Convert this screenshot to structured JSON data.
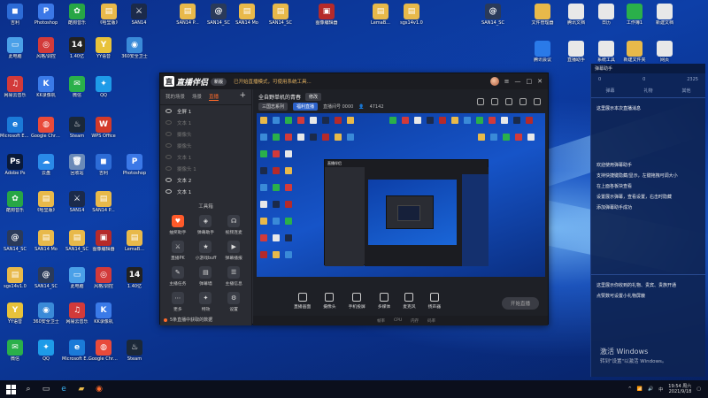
{
  "desktop": {
    "icons": [
      {
        "label": "吉利",
        "color": "#2d6cd6",
        "glyph": "◼"
      },
      {
        "label": "Photoshop",
        "color": "#3b78e7",
        "glyph": "P"
      },
      {
        "label": "酷狗音乐",
        "color": "#27a645",
        "glyph": "✿"
      },
      {
        "label": "《哈里版》",
        "color": "#e8b94a",
        "glyph": "▤"
      },
      {
        "label": "SAN14",
        "color": "#1b2a4a",
        "glyph": "⚔"
      },
      {
        "label": "SAN14 P...",
        "color": "#e8b94a",
        "glyph": "▤"
      },
      {
        "label": "SAN14_SC",
        "color": "#2a3a5a",
        "glyph": "@"
      },
      {
        "label": "SAN14 Mo",
        "color": "#e8b94a",
        "glyph": "▤"
      },
      {
        "label": "SAN14_SC",
        "color": "#e8b94a",
        "glyph": "▤"
      },
      {
        "label": "图像编辑器",
        "color": "#b52a2a",
        "glyph": "▣"
      },
      {
        "label": "LemaB...",
        "color": "#e8b94a",
        "glyph": "▤"
      },
      {
        "label": "sgs14v1.0",
        "color": "#e8b94a",
        "glyph": "▤"
      },
      {
        "label": "SAN14_SC",
        "color": "#2a3a5a",
        "glyph": "@"
      },
      {
        "label": "此电脑",
        "color": "#4aa0e8",
        "glyph": "▭"
      },
      {
        "label": "风格/调控",
        "color": "#d23a3a",
        "glyph": "◎"
      },
      {
        "label": "1.40亿",
        "color": "#222",
        "glyph": "14"
      },
      {
        "label": "YY语音",
        "color": "#e8c23a",
        "glyph": "Y"
      },
      {
        "label": "360安全卫士",
        "color": "#3a8ad8",
        "glyph": "◉"
      },
      {
        "label": "网易云音乐",
        "color": "#d23a3a",
        "glyph": "♫"
      },
      {
        "label": "KK录像机",
        "color": "#3a7ae8",
        "glyph": "K"
      },
      {
        "label": "微信",
        "color": "#2ab04a",
        "glyph": "✉"
      },
      {
        "label": "QQ",
        "color": "#1e9be8",
        "glyph": "✦"
      },
      {
        "label": "Microsoft Edge",
        "color": "#1b7ad8",
        "glyph": "e"
      },
      {
        "label": "Google Chrome",
        "color": "#e84a3a",
        "glyph": "◍"
      },
      {
        "label": "Steam",
        "color": "#1b2838",
        "glyph": "♨"
      },
      {
        "label": "WPS Office",
        "color": "#d33a2a",
        "glyph": "W"
      },
      {
        "label": "Adobe Ps",
        "color": "#0a1a3a",
        "glyph": "Ps"
      },
      {
        "label": "云盘",
        "color": "#2a8ae8",
        "glyph": "☁"
      },
      {
        "label": "回收站",
        "color": "#6a8ab8",
        "glyph": "🗑"
      }
    ],
    "right_icons": [
      {
        "label": "文件管理器",
        "color": "#e8b94a"
      },
      {
        "label": "腾讯文档",
        "color": "#e8e8e8"
      },
      {
        "label": "日历",
        "color": "#e8e8e8"
      },
      {
        "label": "工作簿1",
        "color": "#2ab04a"
      },
      {
        "label": "新建文档",
        "color": "#e8e8e8"
      },
      {
        "label": "腾讯会议",
        "color": "#2a7ae8"
      },
      {
        "label": "直播助手",
        "color": "#e8e8e8"
      },
      {
        "label": "系统工具",
        "color": "#e8e8e8"
      },
      {
        "label": "新建文件夹",
        "color": "#e8b94a"
      },
      {
        "label": "网页",
        "color": "#e8e8e8"
      }
    ]
  },
  "app": {
    "logo_badge": "直",
    "name": "直播伴侣",
    "version": "新版",
    "notice": "已开始直播模式，可使用系统工具...",
    "sidebar": {
      "tabs": [
        "我的场景",
        "场景",
        "直播"
      ],
      "active_tab": "直播",
      "scenes": [
        {
          "label": "全屏 1",
          "dim": false
        },
        {
          "label": "文本 1",
          "dim": true
        },
        {
          "label": "摄像头",
          "dim": true
        },
        {
          "label": "摄像头",
          "dim": true
        },
        {
          "label": "文本 1",
          "dim": true
        },
        {
          "label": "摄像头 1",
          "dim": true
        },
        {
          "label": "文本 2",
          "dim": false
        },
        {
          "label": "文本 1",
          "dim": false
        }
      ],
      "tools_label": "工具箱",
      "tools": [
        {
          "label": "抽奖助手",
          "hot": true,
          "glyph": "♥"
        },
        {
          "label": "弹幕助手",
          "hot": false,
          "glyph": "◈"
        },
        {
          "label": "视频连麦",
          "hot": false,
          "glyph": "☊"
        },
        {
          "label": "直播PK",
          "hot": false,
          "glyph": "⚔"
        },
        {
          "label": "小游戏buff",
          "hot": false,
          "glyph": "★"
        },
        {
          "label": "弹幕播报",
          "hot": false,
          "glyph": "▶"
        },
        {
          "label": "主播任务",
          "hot": false,
          "glyph": "✎"
        },
        {
          "label": "弹幕墙",
          "hot": false,
          "glyph": "▤"
        },
        {
          "label": "主播信息",
          "hot": false,
          "glyph": "☰"
        },
        {
          "label": "更多",
          "hot": false,
          "glyph": "⋯"
        },
        {
          "label": "特效",
          "hot": false,
          "glyph": "✦"
        },
        {
          "label": "设置",
          "hot": false,
          "glyph": "⚙"
        }
      ],
      "footer": "5条直播中获取的数据"
    },
    "stream_title": "全自野单机的青春",
    "edit_label": "修改",
    "meta": {
      "category": "三国志系列",
      "tag": "福利直播",
      "room_id": "直播间号 0000",
      "viewers": "47142"
    },
    "controls": [
      "直播画面",
      "摄像头",
      "手机投屏",
      "多媒体",
      "麦克风",
      "扬声器"
    ],
    "start_live": "开始直播",
    "status": [
      "帧率",
      "CPU",
      "内存",
      "码率"
    ]
  },
  "rpanel": {
    "head": "弹幕助手",
    "stats": [
      "0",
      "0",
      "2325"
    ],
    "tabs": [
      "弹幕",
      "礼物",
      "其他"
    ],
    "title": "这里展示本次直播消息",
    "messages": [
      "欢迎使用弹幕助手",
      "支持快捷键隐藏/显示，左键拖拽可调大小",
      "在上面各板块查看",
      "设置展示弹幕，查看设置，右击时隐藏",
      "添加弹幕助手成功"
    ],
    "bottom": [
      "这里展示你收到的礼物、贵宾、贵族开通",
      "点赞数可设置小礼物屏蔽"
    ]
  },
  "watermark": {
    "title": "激活 Windows",
    "sub": "转到\"设置\"以激活 Windows。"
  },
  "taskbar": {
    "time": "19:54 周六",
    "date": "2021/9/18",
    "lang": "中"
  }
}
